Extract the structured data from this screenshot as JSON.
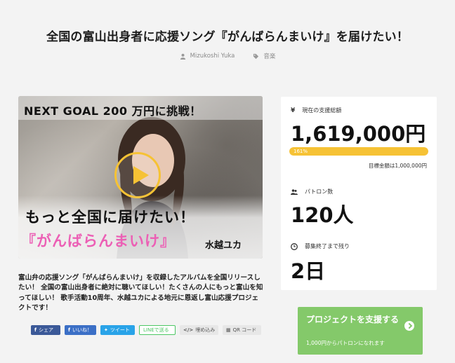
{
  "page": {
    "title": "全国の富山出身者に応援ソング『がんばらんまいけ』を届けたい！",
    "author": "Mizukoshi Yuka",
    "category": "音楽"
  },
  "hero": {
    "next_goal": "NEXT GOAL 200 万円に挑戦！",
    "motto": "もっと全国に届けたい！",
    "song": "『がんばらんまいけ』",
    "artist": "水越ユカ"
  },
  "description": "富山弁の応援ソング「がんばらんまいけ」を収録したアルバムを全国リリースしたい！ 全国の富山出身者に絶対に聴いてほしい！たくさんの人にもっと富山を知ってほしい！ 歌手活動10周年、水越ユカによる地元に恩返し富山応援プロジェクトです！",
  "share": {
    "facebook": "シェア",
    "hatena": "いいね！",
    "twitter": "ツイート",
    "line": "LINEで送る",
    "embed": "埋め込み",
    "qr": "QR コード"
  },
  "stats": {
    "raised_label": "現在の支援総額",
    "raised": "1,619,000円",
    "progress_percent": 161,
    "progress_text": "161%",
    "goal_text": "目標金額は1,000,000円",
    "backers_label": "パトロン数",
    "backers": "120人",
    "remaining_label": "募集終了まで残り",
    "remaining": "2日"
  },
  "support": {
    "label": "プロジェクトを支援する",
    "sub": "1,000円からパトロンになれます"
  },
  "colors": {
    "accent_yellow": "#f6c235",
    "support_green": "#84c96a",
    "pink": "#ec5fb5"
  }
}
